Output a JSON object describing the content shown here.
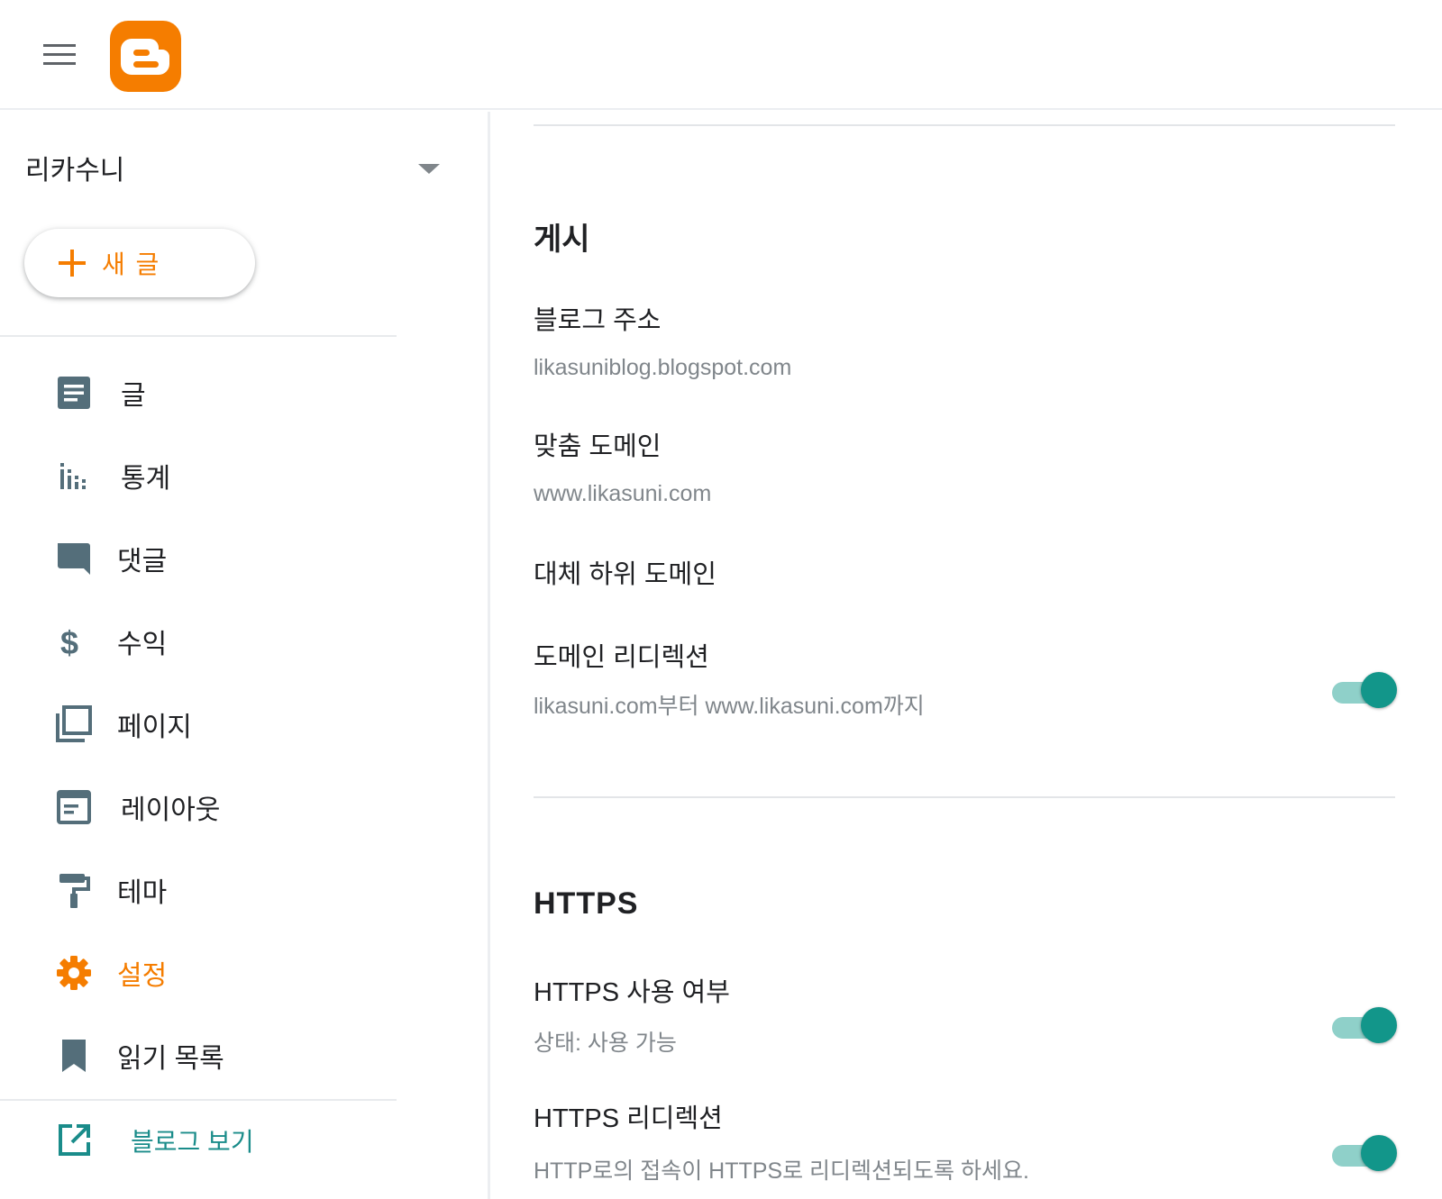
{
  "app": {
    "name": "Blogger"
  },
  "sidebar": {
    "blog_name": "리카수니",
    "new_post_label": "새 글",
    "items": [
      {
        "label": "글",
        "icon": "posts-icon"
      },
      {
        "label": "통계",
        "icon": "stats-icon"
      },
      {
        "label": "댓글",
        "icon": "comments-icon"
      },
      {
        "label": "수익",
        "icon": "earnings-icon"
      },
      {
        "label": "페이지",
        "icon": "pages-icon"
      },
      {
        "label": "레이아웃",
        "icon": "layout-icon"
      },
      {
        "label": "테마",
        "icon": "theme-icon"
      },
      {
        "label": "설정",
        "icon": "settings-icon",
        "active": true
      },
      {
        "label": "읽기 목록",
        "icon": "reading-list-icon"
      }
    ],
    "view_blog_label": "블로그 보기"
  },
  "main": {
    "publishing": {
      "title": "게시",
      "blog_address": {
        "label": "블로그 주소",
        "value": "likasuniblog.blogspot.com"
      },
      "custom_domain": {
        "label": "맞춤 도메인",
        "value": "www.likasuni.com"
      },
      "fallback_subdomain": {
        "label": "대체 하위 도메인"
      },
      "domain_redirect": {
        "label": "도메인 리디렉션",
        "value": "likasuni.com부터 www.likasuni.com까지",
        "enabled": true
      }
    },
    "https": {
      "title": "HTTPS",
      "availability": {
        "label": "HTTPS 사용 여부",
        "value": "상태: 사용 가능",
        "enabled": true
      },
      "redirect": {
        "label": "HTTPS 리디렉션",
        "value": "HTTP로의 접속이 HTTPS로 리디렉션되도록 하세요.",
        "enabled": true
      }
    }
  },
  "colors": {
    "brand": "#f57d00",
    "nav_icon": "#546e7a",
    "toggle_on": "#12968a",
    "toggle_track": "#8fd0c9",
    "link": "#1a8c8a"
  }
}
